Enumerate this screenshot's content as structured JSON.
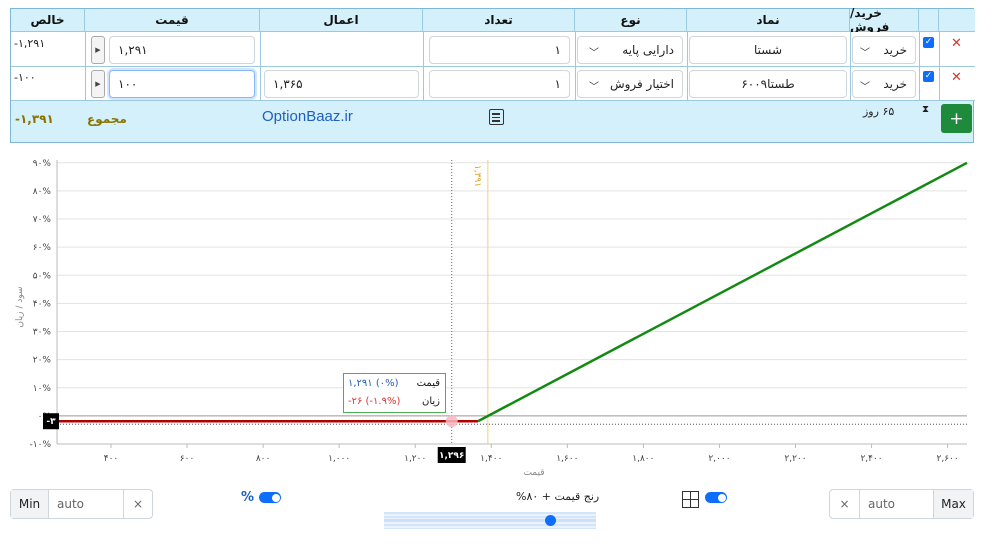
{
  "table": {
    "headers": {
      "buy_sell": "خرید/فروش",
      "symbol": "نماد",
      "type": "نوع",
      "count": "تعداد",
      "strike": "اعمال",
      "price": "قیمت",
      "net": "خالص"
    },
    "rows": [
      {
        "side": "خرید",
        "symbol": "شستا",
        "type": "دارایی پایه",
        "count": "۱",
        "strike": "",
        "price": "۱,۲۹۱",
        "net": "-۱,۲۹۱"
      },
      {
        "side": "خرید",
        "symbol": "طستا۶۰۰۹",
        "type": "اختیار فروش",
        "count": "۱",
        "strike": "۱,۳۶۵",
        "price": "۱۰۰",
        "net": "-۱۰۰"
      }
    ],
    "footer": {
      "days": "۶۵ روز",
      "brand": "OptionBaaz.ir",
      "total_label": "مجموع",
      "total_value": "-۱,۳۹۱",
      "add_symbol": "+"
    }
  },
  "chart_data": {
    "type": "line",
    "title": "",
    "xlabel": "قیمت",
    "ylabel": "سود / زیان",
    "x_ticks": [
      "۴۰۰",
      "۶۰۰",
      "۸۰۰",
      "۱,۰۰۰",
      "۱,۲۰۰",
      "۱,۴۰۰",
      "۱,۶۰۰",
      "۱,۸۰۰",
      "۲,۰۰۰",
      "۲,۲۰۰",
      "۲,۴۰۰",
      "۲,۶۰۰"
    ],
    "x_tick_values": [
      400,
      600,
      800,
      1000,
      1200,
      1400,
      1600,
      1800,
      2000,
      2200,
      2400,
      2600
    ],
    "y_ticks": [
      "۹۰%",
      "۸۰%",
      "۷۰%",
      "۶۰%",
      "۵۰%",
      "۴۰%",
      "۳۰%",
      "۲۰%",
      "۱۰%",
      "۰%",
      "-۱۰%"
    ],
    "y_tick_values": [
      90,
      80,
      70,
      60,
      50,
      40,
      30,
      20,
      10,
      0,
      -10
    ],
    "xlim": [
      258,
      2651
    ],
    "ylim": [
      -10,
      91
    ],
    "series": [
      {
        "color": "#b00000",
        "x": [
          258,
          1365
        ],
        "y": [
          -1.9,
          -1.9
        ]
      },
      {
        "color": "#128a12",
        "x": [
          1365,
          2651
        ],
        "y": [
          -1.9,
          90
        ]
      }
    ],
    "markers": {
      "current_price": 1296,
      "current_price_label": "۱,۲۹۶",
      "breakeven": 1391,
      "breakeven_label": "۱,۳۹۱",
      "min_label": "-۳",
      "min_value": -1.9
    },
    "tooltip": {
      "price_label": "قیمت",
      "price_value": "۱,۲۹۱ (۰%)",
      "pl_label": "زیان",
      "pl_value": "-۲۶ (-۱.۹%)"
    },
    "colors": {
      "profit": "#128a12",
      "loss": "#b00000",
      "breakeven": "#e0a020",
      "tooltip_price": "#1f5fbf",
      "tooltip_loss": "#d33"
    }
  },
  "controls": {
    "min_label": "Min",
    "min_value": "auto",
    "max_label": "Max",
    "max_value": "auto",
    "clear_symbol": "×",
    "percent_symbol": "%",
    "range_label": "رنج قیمت + ۸۰%",
    "range_fraction": 0.8
  }
}
